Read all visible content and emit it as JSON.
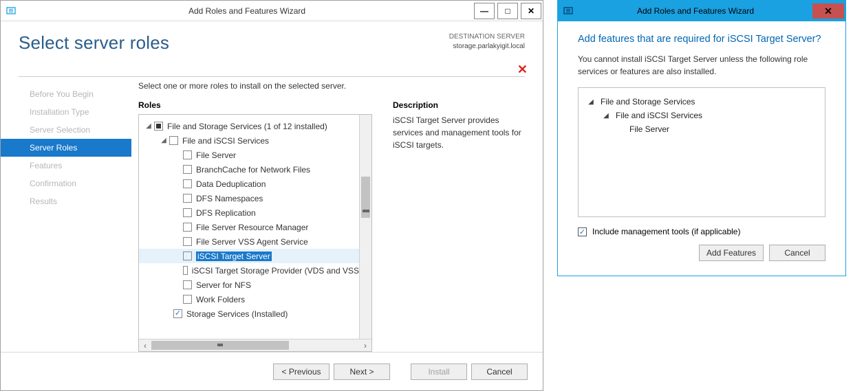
{
  "wizard": {
    "title": "Add Roles and Features Wizard",
    "heading": "Select server roles",
    "destination_label": "DESTINATION SERVER",
    "destination_server": "storage.parlakyigit.local",
    "instruction": "Select one or more roles to install on the selected server.",
    "roles_label": "Roles",
    "description_label": "Description",
    "description_text": "iSCSI Target Server provides services and management tools for iSCSI targets.",
    "steps": [
      "Before You Begin",
      "Installation Type",
      "Server Selection",
      "Server Roles",
      "Features",
      "Confirmation",
      "Results"
    ],
    "roles_tree": {
      "root": "File and Storage Services (1 of 12 installed)",
      "child1": "File and iSCSI Services",
      "items": [
        "File Server",
        "BranchCache for Network Files",
        "Data Deduplication",
        "DFS Namespaces",
        "DFS Replication",
        "File Server Resource Manager",
        "File Server VSS Agent Service",
        "iSCSI Target Server",
        "iSCSI Target Storage Provider (VDS and VSS",
        "Server for NFS",
        "Work Folders"
      ],
      "storage_services": "Storage Services (Installed)"
    },
    "buttons": {
      "previous": "< Previous",
      "next": "Next >",
      "install": "Install",
      "cancel": "Cancel"
    }
  },
  "popup": {
    "title": "Add Roles and Features Wizard",
    "heading": "Add features that are required for iSCSI Target Server?",
    "text": "You cannot install iSCSI Target Server unless the following role services or features are also installed.",
    "tree": {
      "root": "File and Storage Services",
      "child": "File and iSCSI Services",
      "leaf": "File Server"
    },
    "include_label": "Include management tools (if applicable)",
    "buttons": {
      "add": "Add Features",
      "cancel": "Cancel"
    }
  }
}
